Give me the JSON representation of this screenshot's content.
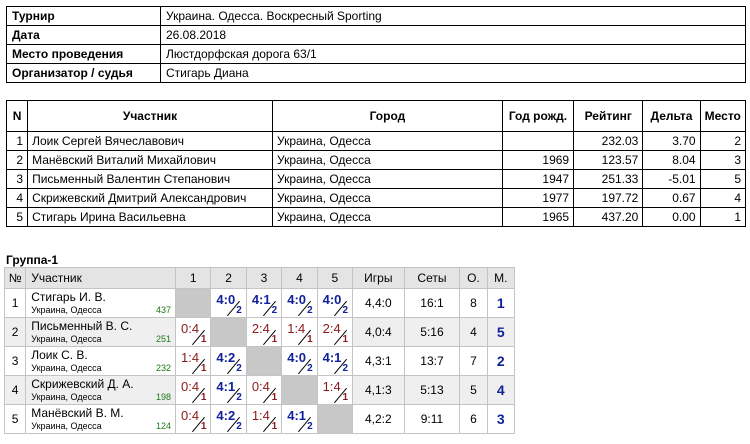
{
  "info": [
    {
      "label": "Турнир",
      "value": "Украина. Одесса. Воскресный Sporting"
    },
    {
      "label": "Дата",
      "value": "26.08.2018"
    },
    {
      "label": "Место проведения",
      "value": "Люстдорфская дорога 63/1"
    },
    {
      "label": "Организатор / судья",
      "value": "Стигарь Диана"
    }
  ],
  "players_table": {
    "headers": [
      "N",
      "Участник",
      "Город",
      "Год рожд.",
      "Рейтинг",
      "Дельта",
      "Место"
    ],
    "rows": [
      [
        "1",
        "Лоик Сергей Вячеславович",
        "Украина, Одесса",
        "",
        "232.03",
        "3.70",
        "2"
      ],
      [
        "2",
        "Манёвский Виталий Михайлович",
        "Украина, Одесса",
        "1969",
        "123.57",
        "8.04",
        "3"
      ],
      [
        "3",
        "Письменный Валентин Степанович",
        "Украина, Одесса",
        "1947",
        "251.33",
        "-5.01",
        "5"
      ],
      [
        "4",
        "Скрижевский Дмитрий Александрович",
        "Украина, Одесса",
        "1977",
        "197.72",
        "0.67",
        "4"
      ],
      [
        "5",
        "Стигарь Ирина Васильевна",
        "Украина, Одесса",
        "1965",
        "437.20",
        "0.00",
        "1"
      ]
    ]
  },
  "group": {
    "title": "Группа-1",
    "headers": [
      "№",
      "Участник",
      "1",
      "2",
      "3",
      "4",
      "5",
      "Игры",
      "Сеты",
      "О.",
      "М."
    ],
    "rows": [
      {
        "n": "1",
        "name": "Стигарь И. В.",
        "city": "Украина, Одесса",
        "rating": "437",
        "results": [
          null,
          {
            "s": "4:0",
            "b": "2",
            "w": true
          },
          {
            "s": "4:1",
            "b": "2",
            "w": true
          },
          {
            "s": "4:0",
            "b": "2",
            "w": true
          },
          {
            "s": "4:0",
            "b": "2",
            "w": true
          }
        ],
        "games": "4,4:0",
        "sets": "16:1",
        "points": "8",
        "place": "1"
      },
      {
        "n": "2",
        "name": "Письменный В. С.",
        "city": "Украина, Одесса",
        "rating": "251",
        "results": [
          {
            "s": "0:4",
            "b": "1",
            "w": false
          },
          null,
          {
            "s": "2:4",
            "b": "1",
            "w": false
          },
          {
            "s": "1:4",
            "b": "1",
            "w": false
          },
          {
            "s": "2:4",
            "b": "1",
            "w": false
          }
        ],
        "games": "4,0:4",
        "sets": "5:16",
        "points": "4",
        "place": "5"
      },
      {
        "n": "3",
        "name": "Лоик С. В.",
        "city": "Украина, Одесса",
        "rating": "232",
        "results": [
          {
            "s": "1:4",
            "b": "1",
            "w": false
          },
          {
            "s": "4:2",
            "b": "2",
            "w": true
          },
          null,
          {
            "s": "4:0",
            "b": "2",
            "w": true
          },
          {
            "s": "4:1",
            "b": "2",
            "w": true
          }
        ],
        "games": "4,3:1",
        "sets": "13:7",
        "points": "7",
        "place": "2"
      },
      {
        "n": "4",
        "name": "Скрижевский Д. А.",
        "city": "Украина, Одесса",
        "rating": "198",
        "results": [
          {
            "s": "0:4",
            "b": "1",
            "w": false
          },
          {
            "s": "4:1",
            "b": "2",
            "w": true
          },
          {
            "s": "0:4",
            "b": "1",
            "w": false
          },
          null,
          {
            "s": "1:4",
            "b": "1",
            "w": false
          }
        ],
        "games": "4,1:3",
        "sets": "5:13",
        "points": "5",
        "place": "4"
      },
      {
        "n": "5",
        "name": "Манёвский В. М.",
        "city": "Украина, Одесса",
        "rating": "124",
        "results": [
          {
            "s": "0:4",
            "b": "1",
            "w": false
          },
          {
            "s": "4:2",
            "b": "2",
            "w": true
          },
          {
            "s": "1:4",
            "b": "1",
            "w": false
          },
          {
            "s": "4:1",
            "b": "2",
            "w": true
          },
          null
        ],
        "games": "4,2:2",
        "sets": "9:11",
        "points": "6",
        "place": "3"
      }
    ]
  }
}
